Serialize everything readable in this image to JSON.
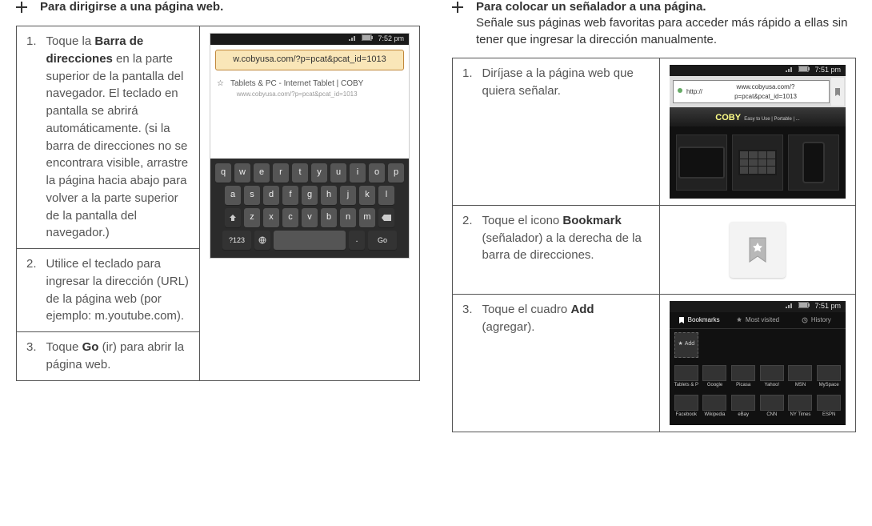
{
  "left": {
    "heading": "Para dirigirse a una página web.",
    "steps": [
      {
        "num": "1.",
        "pre": "Toque la ",
        "bold": "Barra de direcciones",
        "post": " en la parte superior de la pantalla del navegador. El teclado en pantalla se abrirá automáticamente. (si la barra de direcciones no se encontrara visible, arrastre la página hacia abajo para volver a la parte superior de la pantalla del navegador.)"
      },
      {
        "num": "2.",
        "text": "Utilice el teclado para ingresar la dirección (URL) de la página web (por ejemplo: m.youtube.com)."
      },
      {
        "num": "3.",
        "pre": "Toque ",
        "bold": "Go",
        "mid": " (ir) para abrir la página web."
      }
    ],
    "shot": {
      "time": "7:52 pm",
      "url": "w.cobyusa.com/?p=pcat&pcat_id=1013",
      "tab_caption": "Tablets & PC - Internet Tablet | COBY",
      "sub_url": "www.cobyusa.com/?p=pcat&pcat_id=1013",
      "kbd_rows": [
        [
          "q",
          "w",
          "e",
          "r",
          "t",
          "y",
          "u",
          "i",
          "o",
          "p"
        ],
        [
          "a",
          "s",
          "d",
          "f",
          "g",
          "h",
          "j",
          "k",
          "l"
        ],
        [
          "z",
          "x",
          "c",
          "v",
          "b",
          "n",
          "m"
        ]
      ],
      "bottom_row": {
        "left": "?123",
        "right": "Go",
        "period": "."
      }
    }
  },
  "right": {
    "heading": "Para colocar un señalador a una página.",
    "subheading": "Señale sus páginas web favoritas para acceder más rápido a ellas sin tener que ingresar la dirección manualmente.",
    "steps": [
      {
        "num": "1.",
        "text": "Diríjase a la página web que quiera señalar."
      },
      {
        "num": "2.",
        "pre": "Toque el icono ",
        "bold": "Bookmark",
        "post": " (señalador) a la derecha de la barra de direcciones."
      },
      {
        "num": "3.",
        "pre": "Toque el cuadro ",
        "bold": "Add",
        "post": " (agregar)."
      }
    ],
    "shot1": {
      "time": "7:51 pm",
      "url_prefix": "http://",
      "url": "www.cobyusa.com/?p=pcat&pcat_id=1013",
      "logo": "COBY",
      "tagline": "Easy to Use | Portable | ..."
    },
    "shot3": {
      "time": "7:51 pm",
      "tabs": [
        "Bookmarks",
        "Most visited",
        "History"
      ],
      "add_label": "Add",
      "items_row1": [
        "Tablets & P",
        "Google",
        "Picasa",
        "Yahoo!",
        "MSN",
        "MySpace"
      ],
      "items_row2": [
        "Facebook",
        "Wikipedia",
        "eBay",
        "CNN",
        "NY Times",
        "ESPN"
      ]
    }
  }
}
